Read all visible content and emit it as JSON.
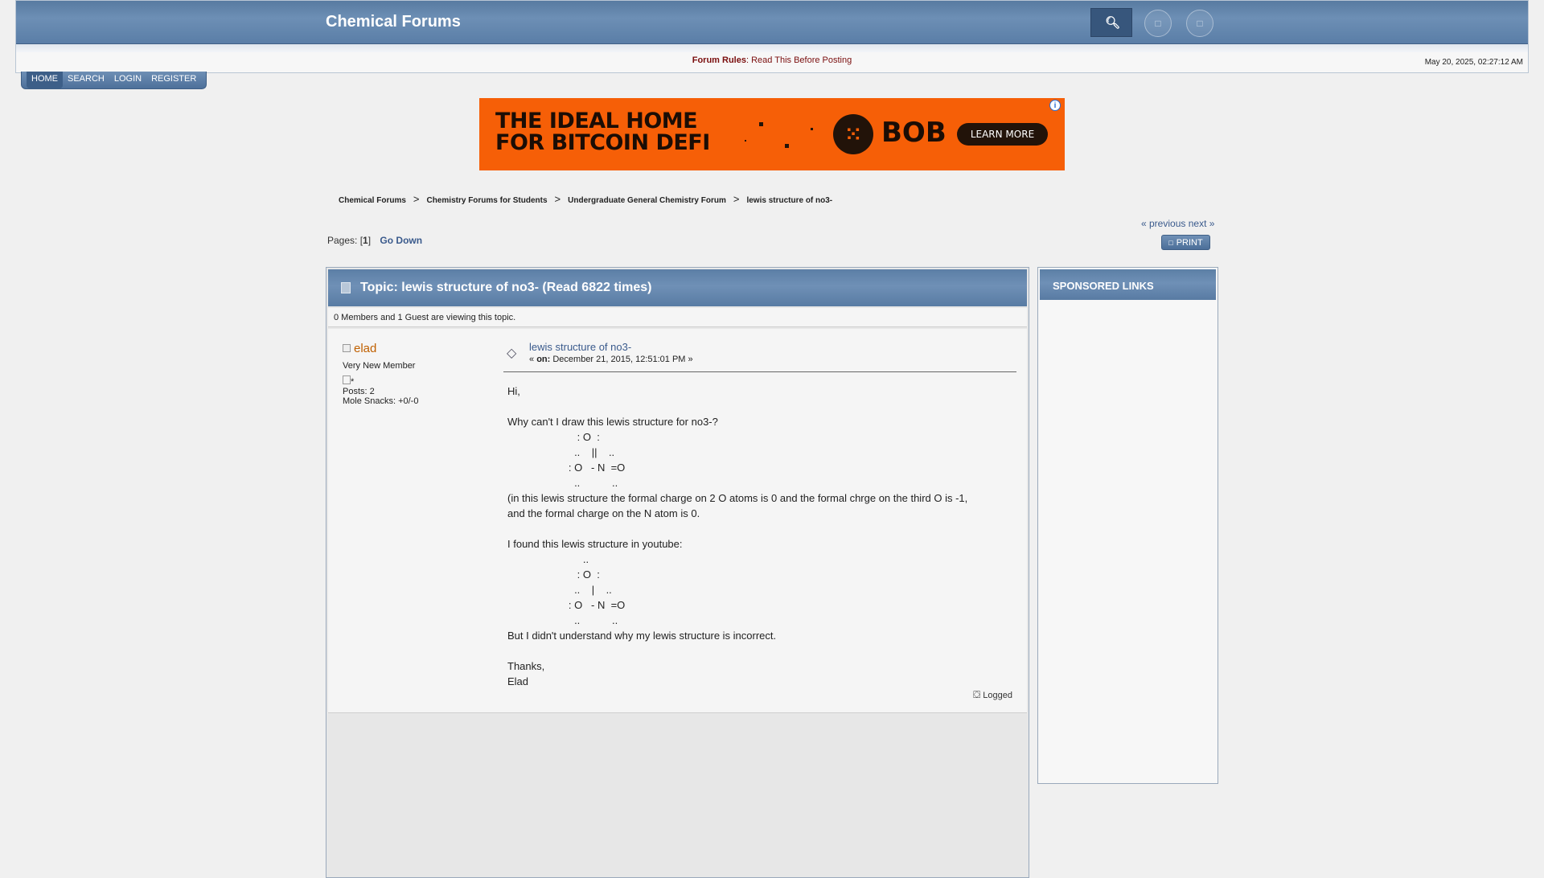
{
  "header": {
    "site_title": "Chemical Forums",
    "rules_label": "Forum Rules",
    "rules_link": "Read This Before Posting",
    "datetime": "May 20, 2025, 02:27:12 AM"
  },
  "nav": {
    "items": [
      "HOME",
      "SEARCH",
      "LOGIN",
      "REGISTER"
    ]
  },
  "ad": {
    "headline_line1": "THE IDEAL HOME",
    "headline_line2": "FOR BITCOIN DEFI",
    "brand": "BOB",
    "cta": "LEARN MORE"
  },
  "breadcrumb": [
    "Chemical Forums",
    "Chemistry Forums for Students",
    "Undergraduate General Chemistry Forum",
    "lewis structure of no3-"
  ],
  "pagination": {
    "prev": "« previous",
    "next": "next »",
    "pages_label": "Pages: [",
    "current_page": "1",
    "pages_close": "]",
    "go_down": "Go Down",
    "print": "PRINT"
  },
  "topic": {
    "title": "Topic: lewis structure of no3-  (Read 6822 times)",
    "viewers": "0 Members and 1 Guest are viewing this topic."
  },
  "post": {
    "poster_name": "elad",
    "poster_rank": "Very New Member",
    "poster_avatar_alt": "*",
    "poster_posts": "Posts: 2",
    "poster_snacks": "Mole Snacks: +0/-0",
    "subject": "lewis structure of no3-",
    "date_prefix": "« ",
    "date_on": "on:",
    "date_value": " December 21, 2015, 12:51:01 PM »",
    "body": "Hi,\n\nWhy can't I draw this lewis structure for no3-?\n                        : O  :\n                       ..    ||    ..\n                     : O   - N  =O\n                       ..           ..\n(in this lewis structure the formal charge on 2 O atoms is 0 and the formal chrge on the third O is -1,\nand the formal charge on the N atom is 0.\n\nI found this lewis structure in youtube:\n                          ..\n                        : O  :\n                       ..    |    ..\n                     : O   - N  =O\n                       ..           ..\nBut I didn't understand why my lewis structure is incorrect.\n\nThanks,\nElad",
    "logged": "Logged"
  },
  "sidebar": {
    "title": "SPONSORED LINKS"
  }
}
